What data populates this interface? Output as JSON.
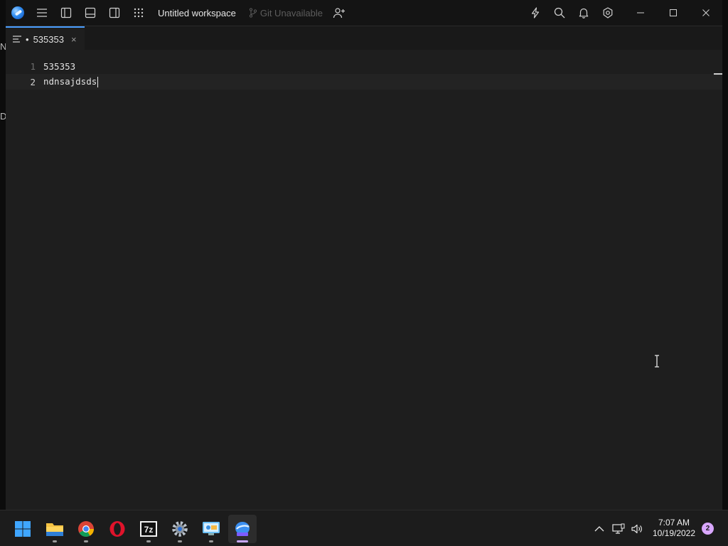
{
  "window": {
    "workspace_title": "Untitled workspace",
    "git_status": "Git Unavailable",
    "icons": [
      "app-logo",
      "menu-icon",
      "left-sidebar-icon",
      "bottom-panel-icon",
      "right-sidebar-icon",
      "apps-grid-icon",
      "git-branch-icon",
      "add-collaborator-icon",
      "lightning-icon",
      "search-icon",
      "bell-icon",
      "settings-icon",
      "minimize-icon",
      "maximize-icon",
      "close-icon"
    ]
  },
  "tabs": [
    {
      "label": "535353",
      "modified_marker": "•",
      "close": "×"
    }
  ],
  "editor": {
    "lines": [
      {
        "number": "1",
        "text": "535353"
      },
      {
        "number": "2",
        "text": "ndnsajdsds"
      }
    ],
    "active_line": 2
  },
  "desktop_edge": {
    "top_glyph": "N",
    "mid_glyph": "D"
  },
  "taskbar": {
    "apps": [
      "start",
      "file-explorer",
      "chrome",
      "opera",
      "7-zip",
      "settings",
      "remote-desktop",
      "active-editor"
    ],
    "time": "7:07 AM",
    "date": "10/19/2022",
    "notification_count": "2"
  },
  "colors": {
    "accent": "#4a9eff",
    "background": "#1e1e1e",
    "titlebar": "#141414"
  }
}
